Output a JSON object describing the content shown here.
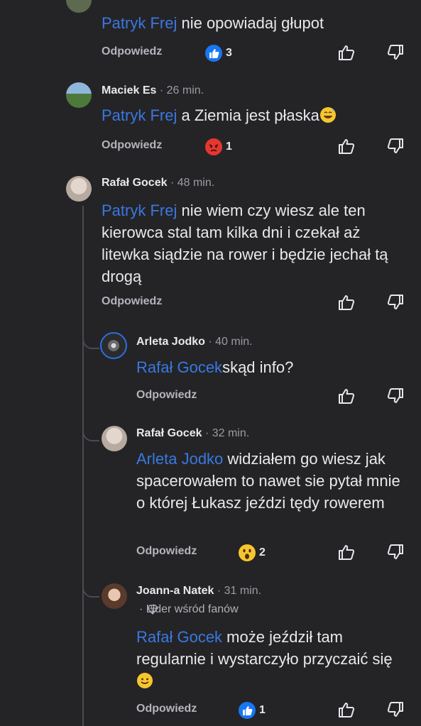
{
  "comments": [
    {
      "author": "",
      "time": "",
      "mention": "Patryk Frej",
      "text": " nie opowiadaj głupot",
      "reply": "Odpowiedz",
      "reaction": "like",
      "reaction_count": "3"
    },
    {
      "author": "Maciek Es",
      "time": "· 26 min.",
      "mention": "Patryk Frej",
      "text": " a Ziemia jest płaska",
      "reply": "Odpowiedz",
      "reaction": "angry",
      "reaction_count": "1"
    },
    {
      "author": "Rafał Gocek",
      "time": "· 48 min.",
      "mention": "Patryk Frej",
      "text": " nie wiem czy wiesz ale ten kierowca stal tam kilka dni i czekał aż litewka siądzie na rower i będzie jechał tą drogą",
      "reply": "Odpowiedz"
    },
    {
      "author": "Arleta Jodko",
      "time": "· 40 min.",
      "mention": "Rafał Gocek",
      "text": "skąd info?",
      "reply": "Odpowiedz"
    },
    {
      "author": "Rafał Gocek",
      "time": "· 32 min.",
      "mention": "Arleta Jodko",
      "text": " widziałem go wiesz jak spacerowałem to nawet sie pytał mnie o której Łukasz jeździ tędy rowerem",
      "reply": "Odpowiedz",
      "reaction": "wow",
      "reaction_count": "2"
    },
    {
      "author": "Joann-a Natek",
      "time": "· 31 min.",
      "badge": "· Lider wśród fanów",
      "mention": "Rafał Gocek",
      "text": " może jeździł tam regularnie i wystarczyło przyczaić się",
      "reply": "Odpowiedz",
      "reaction": "like",
      "reaction_count": "1"
    }
  ],
  "colors": {
    "background": "#242427",
    "mention": "#3a78e0",
    "text": "#e8e9ec",
    "muted": "#9a9ca3",
    "like_blue": "#1877f2",
    "angry_red": "#e6372f",
    "wow_yellow": "#f7c52e"
  },
  "icons": [
    "like-icon",
    "dislike-icon",
    "like-reaction-icon",
    "angry-reaction-icon",
    "wow-reaction-icon",
    "sweat-smile-emoji",
    "smile-emoji",
    "diamond-icon"
  ]
}
